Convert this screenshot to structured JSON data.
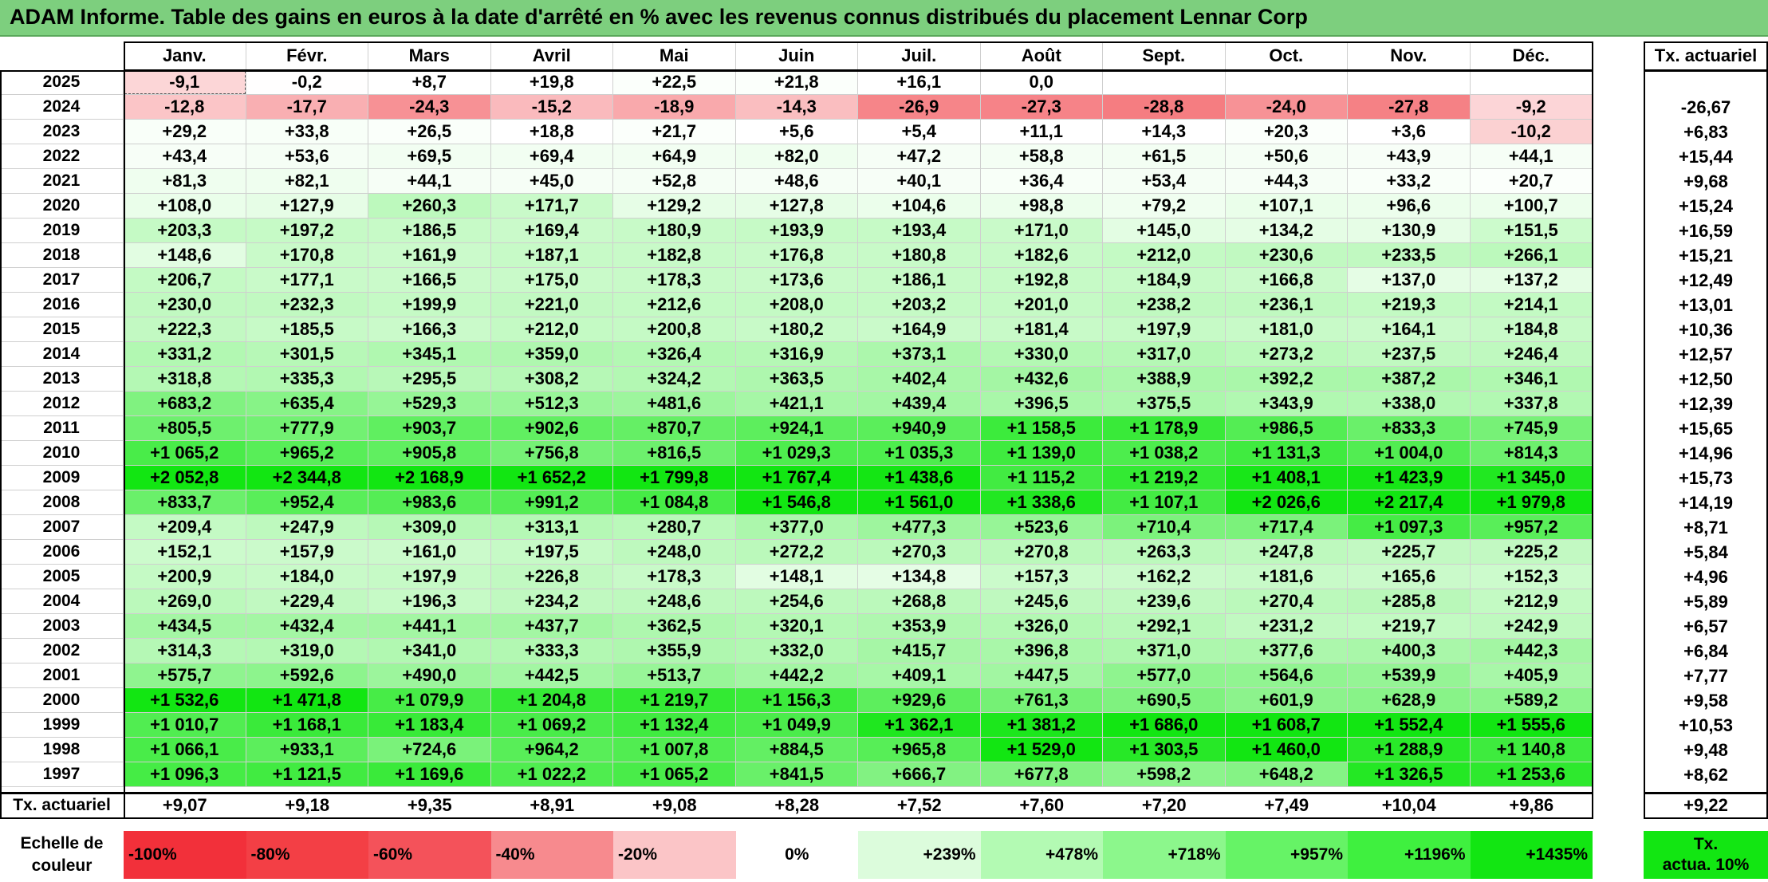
{
  "title": "ADAM Informe. Table des gains en euros à la date d'arrêté en % avec les revenus connus distribués du placement Lennar Corp",
  "months": [
    "Janv.",
    "Févr.",
    "Mars",
    "Avril",
    "Mai",
    "Juin",
    "Juil.",
    "Août",
    "Sept.",
    "Oct.",
    "Nov.",
    "Déc."
  ],
  "actuarial_header": "Tx. actuariel",
  "rows": [
    {
      "year": "2025",
      "values": [
        "-9,1",
        "-0,2",
        "+8,7",
        "+19,8",
        "+22,5",
        "+21,8",
        "+16,1",
        "0,0",
        "",
        "",
        "",
        ""
      ],
      "rate": ""
    },
    {
      "year": "2024",
      "values": [
        "-12,8",
        "-17,7",
        "-24,3",
        "-15,2",
        "-18,9",
        "-14,3",
        "-26,9",
        "-27,3",
        "-28,8",
        "-24,0",
        "-27,8",
        "-9,2"
      ],
      "rate": "-26,67"
    },
    {
      "year": "2023",
      "values": [
        "+29,2",
        "+33,8",
        "+26,5",
        "+18,8",
        "+21,7",
        "+5,6",
        "+5,4",
        "+11,1",
        "+14,3",
        "+20,3",
        "+3,6",
        "-10,2"
      ],
      "rate": "+6,83"
    },
    {
      "year": "2022",
      "values": [
        "+43,4",
        "+53,6",
        "+69,5",
        "+69,4",
        "+64,9",
        "+82,0",
        "+47,2",
        "+58,8",
        "+61,5",
        "+50,6",
        "+43,9",
        "+44,1"
      ],
      "rate": "+15,44"
    },
    {
      "year": "2021",
      "values": [
        "+81,3",
        "+82,1",
        "+44,1",
        "+45,0",
        "+52,8",
        "+48,6",
        "+40,1",
        "+36,4",
        "+53,4",
        "+44,3",
        "+33,2",
        "+20,7"
      ],
      "rate": "+9,68"
    },
    {
      "year": "2020",
      "values": [
        "+108,0",
        "+127,9",
        "+260,3",
        "+171,7",
        "+129,2",
        "+127,8",
        "+104,6",
        "+98,8",
        "+79,2",
        "+107,1",
        "+96,6",
        "+100,7"
      ],
      "rate": "+15,24"
    },
    {
      "year": "2019",
      "values": [
        "+203,3",
        "+197,2",
        "+186,5",
        "+169,4",
        "+180,9",
        "+193,9",
        "+193,4",
        "+171,0",
        "+145,0",
        "+134,2",
        "+130,9",
        "+151,5"
      ],
      "rate": "+16,59"
    },
    {
      "year": "2018",
      "values": [
        "+148,6",
        "+170,8",
        "+161,9",
        "+187,1",
        "+182,8",
        "+176,8",
        "+180,8",
        "+182,6",
        "+212,0",
        "+230,6",
        "+233,5",
        "+266,1"
      ],
      "rate": "+15,21"
    },
    {
      "year": "2017",
      "values": [
        "+206,7",
        "+177,1",
        "+166,5",
        "+175,0",
        "+178,3",
        "+173,6",
        "+186,1",
        "+192,8",
        "+184,9",
        "+166,8",
        "+137,0",
        "+137,2"
      ],
      "rate": "+12,49"
    },
    {
      "year": "2016",
      "values": [
        "+230,0",
        "+232,3",
        "+199,9",
        "+221,0",
        "+212,6",
        "+208,0",
        "+203,2",
        "+201,0",
        "+238,2",
        "+236,1",
        "+219,3",
        "+214,1"
      ],
      "rate": "+13,01"
    },
    {
      "year": "2015",
      "values": [
        "+222,3",
        "+185,5",
        "+166,3",
        "+212,0",
        "+200,8",
        "+180,2",
        "+164,9",
        "+181,4",
        "+197,9",
        "+181,0",
        "+164,1",
        "+184,8"
      ],
      "rate": "+10,36"
    },
    {
      "year": "2014",
      "values": [
        "+331,2",
        "+301,5",
        "+345,1",
        "+359,0",
        "+326,4",
        "+316,9",
        "+373,1",
        "+330,0",
        "+317,0",
        "+273,2",
        "+237,5",
        "+246,4"
      ],
      "rate": "+12,57"
    },
    {
      "year": "2013",
      "values": [
        "+318,8",
        "+335,3",
        "+295,5",
        "+308,2",
        "+324,2",
        "+363,5",
        "+402,4",
        "+432,6",
        "+388,9",
        "+392,2",
        "+387,2",
        "+346,1"
      ],
      "rate": "+12,50"
    },
    {
      "year": "2012",
      "values": [
        "+683,2",
        "+635,4",
        "+529,3",
        "+512,3",
        "+481,6",
        "+421,1",
        "+439,4",
        "+396,5",
        "+375,5",
        "+343,9",
        "+338,0",
        "+337,8"
      ],
      "rate": "+12,39"
    },
    {
      "year": "2011",
      "values": [
        "+805,5",
        "+777,9",
        "+903,7",
        "+902,6",
        "+870,7",
        "+924,1",
        "+940,9",
        "+1 158,5",
        "+1 178,9",
        "+986,5",
        "+833,3",
        "+745,9"
      ],
      "rate": "+15,65"
    },
    {
      "year": "2010",
      "values": [
        "+1 065,2",
        "+965,2",
        "+905,8",
        "+756,8",
        "+816,5",
        "+1 029,3",
        "+1 035,3",
        "+1 139,0",
        "+1 038,2",
        "+1 131,3",
        "+1 004,0",
        "+814,3"
      ],
      "rate": "+14,96"
    },
    {
      "year": "2009",
      "values": [
        "+2 052,8",
        "+2 344,8",
        "+2 168,9",
        "+1 652,2",
        "+1 799,8",
        "+1 767,4",
        "+1 438,6",
        "+1 115,2",
        "+1 219,2",
        "+1 408,1",
        "+1 423,9",
        "+1 345,0"
      ],
      "rate": "+15,73"
    },
    {
      "year": "2008",
      "values": [
        "+833,7",
        "+952,4",
        "+983,6",
        "+991,2",
        "+1 084,8",
        "+1 546,8",
        "+1 561,0",
        "+1 338,6",
        "+1 107,1",
        "+2 026,6",
        "+2 217,4",
        "+1 979,8"
      ],
      "rate": "+14,19"
    },
    {
      "year": "2007",
      "values": [
        "+209,4",
        "+247,9",
        "+309,0",
        "+313,1",
        "+280,7",
        "+377,0",
        "+477,3",
        "+523,6",
        "+710,4",
        "+717,4",
        "+1 097,3",
        "+957,2"
      ],
      "rate": "+8,71"
    },
    {
      "year": "2006",
      "values": [
        "+152,1",
        "+157,9",
        "+161,0",
        "+197,5",
        "+248,0",
        "+272,2",
        "+270,3",
        "+270,8",
        "+263,3",
        "+247,8",
        "+225,7",
        "+225,2"
      ],
      "rate": "+5,84"
    },
    {
      "year": "2005",
      "values": [
        "+200,9",
        "+184,0",
        "+197,9",
        "+226,8",
        "+178,3",
        "+148,1",
        "+134,8",
        "+157,3",
        "+162,2",
        "+181,6",
        "+165,6",
        "+152,3"
      ],
      "rate": "+4,96"
    },
    {
      "year": "2004",
      "values": [
        "+269,0",
        "+229,4",
        "+196,3",
        "+234,2",
        "+248,6",
        "+254,6",
        "+268,8",
        "+245,6",
        "+239,6",
        "+270,4",
        "+285,8",
        "+212,9"
      ],
      "rate": "+5,89"
    },
    {
      "year": "2003",
      "values": [
        "+434,5",
        "+432,4",
        "+441,1",
        "+437,7",
        "+362,5",
        "+320,1",
        "+353,9",
        "+326,0",
        "+292,1",
        "+231,2",
        "+219,7",
        "+242,9"
      ],
      "rate": "+6,57"
    },
    {
      "year": "2002",
      "values": [
        "+314,3",
        "+319,0",
        "+341,0",
        "+333,3",
        "+355,9",
        "+332,0",
        "+415,7",
        "+396,8",
        "+371,0",
        "+377,6",
        "+400,3",
        "+442,3"
      ],
      "rate": "+6,84"
    },
    {
      "year": "2001",
      "values": [
        "+575,7",
        "+592,6",
        "+490,0",
        "+442,5",
        "+513,7",
        "+442,2",
        "+409,1",
        "+447,5",
        "+577,0",
        "+564,6",
        "+539,9",
        "+405,9"
      ],
      "rate": "+7,77"
    },
    {
      "year": "2000",
      "values": [
        "+1 532,6",
        "+1 471,8",
        "+1 079,9",
        "+1 204,8",
        "+1 219,7",
        "+1 156,3",
        "+929,6",
        "+761,3",
        "+690,5",
        "+601,9",
        "+628,9",
        "+589,2"
      ],
      "rate": "+9,58"
    },
    {
      "year": "1999",
      "values": [
        "+1 010,7",
        "+1 168,1",
        "+1 183,4",
        "+1 069,2",
        "+1 132,4",
        "+1 049,9",
        "+1 362,1",
        "+1 381,2",
        "+1 686,0",
        "+1 608,7",
        "+1 552,4",
        "+1 555,6"
      ],
      "rate": "+10,53"
    },
    {
      "year": "1998",
      "values": [
        "+1 066,1",
        "+933,1",
        "+724,6",
        "+964,2",
        "+1 007,8",
        "+884,5",
        "+965,8",
        "+1 529,0",
        "+1 303,5",
        "+1 460,0",
        "+1 288,9",
        "+1 140,8"
      ],
      "rate": "+9,48"
    },
    {
      "year": "1997",
      "values": [
        "+1 096,3",
        "+1 121,5",
        "+1 169,6",
        "+1 022,2",
        "+1 065,2",
        "+841,5",
        "+666,7",
        "+677,8",
        "+598,2",
        "+648,2",
        "+1 326,5",
        "+1 253,6"
      ],
      "rate": "+8,62"
    }
  ],
  "footer": {
    "label": "Tx. actuariel",
    "values": [
      "+9,07",
      "+9,18",
      "+9,35",
      "+8,91",
      "+9,08",
      "+8,28",
      "+7,52",
      "+7,60",
      "+7,20",
      "+7,49",
      "+10,04",
      "+9,86"
    ],
    "total": "+9,22"
  },
  "scale": {
    "label_line1": "Echelle de",
    "label_line2": "couleur",
    "steps": [
      {
        "text": "-100%",
        "color": "#f2303a"
      },
      {
        "text": "-80%",
        "color": "#f33f45"
      },
      {
        "text": "-60%",
        "color": "#f4525a"
      },
      {
        "text": "-40%",
        "color": "#f78a8e"
      },
      {
        "text": "-20%",
        "color": "#fbc5c7"
      },
      {
        "text": "0%",
        "color": "#ffffff"
      },
      {
        "text": "+239%",
        "color": "#dcfcdc"
      },
      {
        "text": "+478%",
        "color": "#b3fab3"
      },
      {
        "text": "+718%",
        "color": "#8cf78c"
      },
      {
        "text": "+957%",
        "color": "#66f366"
      },
      {
        "text": "+1196%",
        "color": "#3ff03f"
      },
      {
        "text": "+1435%",
        "color": "#12e612"
      }
    ],
    "end_line1": "Tx.",
    "end_line2": "actua. 10%",
    "end_color": "#12e612"
  },
  "colors": {
    "title_bg": "#7dcf7e",
    "negative_strong": "#f2303a",
    "positive_strong": "#12e612"
  }
}
